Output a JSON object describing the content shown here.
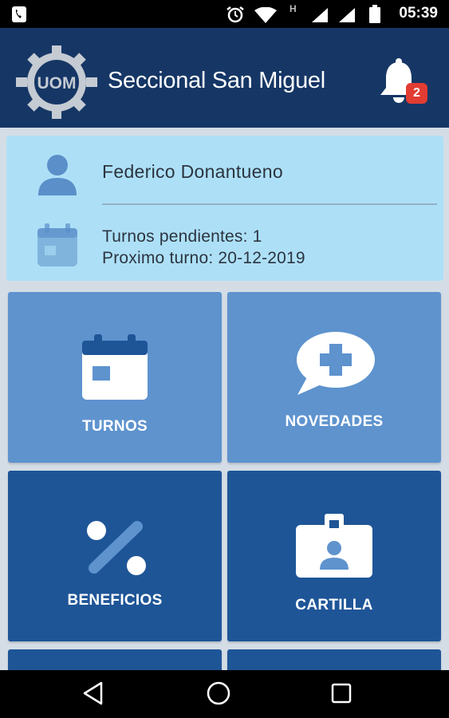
{
  "status_bar": {
    "time": "05:39",
    "network_letter": "H"
  },
  "header": {
    "title": "Seccional San Miguel",
    "logo_text": "UOM",
    "notification_count": "2"
  },
  "user_card": {
    "name": "Federico Donantueno",
    "pending_label": "Turnos pendientes: 1",
    "next_label": "Proximo turno: 20-12-2019"
  },
  "menu": {
    "turnos": "TURNOS",
    "novedades": "NOVEDADES",
    "beneficios": "BENEFICIOS",
    "cartilla": "CARTILLA"
  },
  "colors": {
    "app_bar": "#163766",
    "card_bg": "#ade0f7",
    "tile_light": "#5e93ce",
    "tile_dark": "#1e5597",
    "badge": "#e23c33"
  }
}
